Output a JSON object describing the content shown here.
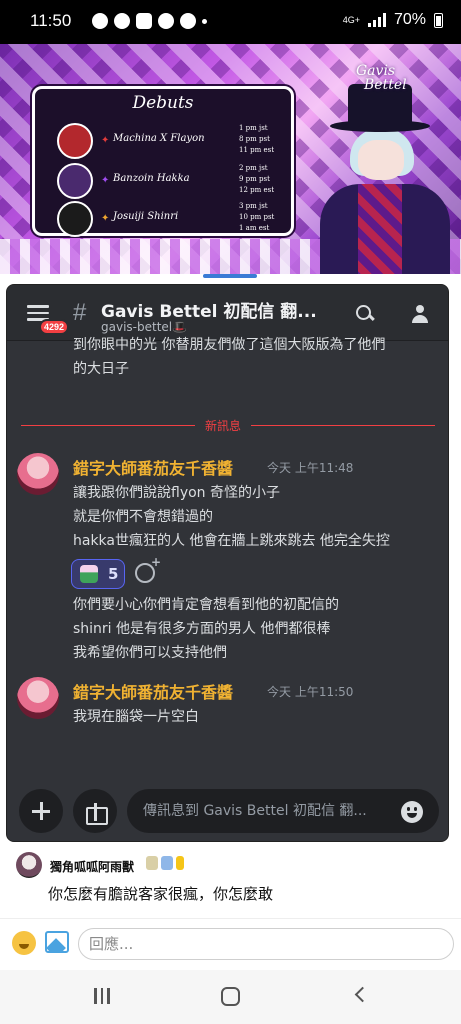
{
  "status_bar": {
    "time": "11:50",
    "network": "4G+",
    "battery": "70%"
  },
  "stream": {
    "logo_line1": "Gavis",
    "logo_line2": "Bettel",
    "debuts": {
      "title": "Debuts",
      "rows": [
        {
          "name": "Machina X Flayon",
          "star_color": "#e23b3b",
          "avatar_color": "#b3282d",
          "times": [
            "1 pm jst",
            "8 pm pst",
            "11 pm est"
          ]
        },
        {
          "name": "Banzoin Hakka",
          "star_color": "#a04cf0",
          "avatar_color": "#4a2a6e",
          "times": [
            "2 pm jst",
            "9 pm pst",
            "12 pm est"
          ]
        },
        {
          "name": "Josuiji Shinri",
          "star_color": "#f0a630",
          "avatar_color": "#1b1b1b",
          "times": [
            "3 pm jst",
            "10 pm pst",
            "1 am est"
          ]
        }
      ]
    }
  },
  "discord": {
    "mention_count": "4292",
    "channel_title": "Gavis Bettel 初配信 翻...",
    "channel_sub": "gavis-bettel🎩",
    "previous_message": [
      "到你眼中的光 你替朋友們做了這個大阪版為了他們",
      "的大日子"
    ],
    "new_messages_label": "新訊息",
    "messages": [
      {
        "author": "錯字大師番茄友千香醬",
        "timestamp": "今天 上午11:48",
        "lines": [
          "讓我跟你們說說flyon 奇怪的小子",
          "就是你們不會想錯過的",
          "hakka世瘋狂的人 他會在牆上跳來跳去 他完全失控"
        ],
        "reaction_count": "5",
        "lines_after": [
          "你們要小心你們肯定會想看到他的初配信的",
          "shinri 他是有很多方面的男人 他們都很棒",
          "我希望你們可以支持他們"
        ]
      },
      {
        "author": "錯字大師番茄友千香醬",
        "timestamp": "今天 上午11:50",
        "lines": [
          "我現在腦袋一片空白"
        ]
      }
    ],
    "composer_placeholder": "傳訊息到 Gavis Bettel 初配信 翻..."
  },
  "comment": {
    "author": "獨角呱呱阿雨獸",
    "text": "你怎麼有膽說客家很瘋，你怎麼敢"
  },
  "reply": {
    "placeholder": "回應..."
  },
  "colors": {
    "discord_bg": "#313338",
    "author_color": "#f0b232",
    "new_divider": "#f23f43",
    "reaction_bg": "#383a6c"
  }
}
